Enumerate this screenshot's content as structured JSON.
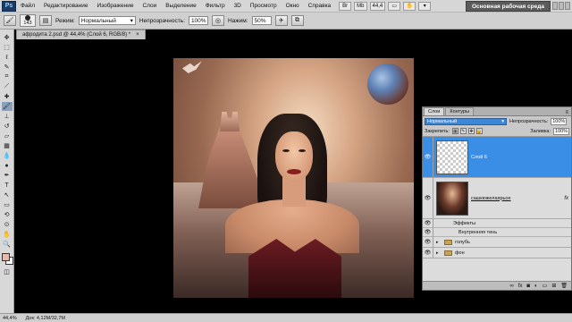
{
  "app": {
    "logo": "Ps"
  },
  "menu": [
    "Файл",
    "Редактирование",
    "Изображение",
    "Слои",
    "Выделение",
    "Фильтр",
    "3D",
    "Просмотр",
    "Окно",
    "Справка"
  ],
  "menu_tools": [
    "Br",
    "Mb",
    "44,4",
    "▭",
    "✋",
    "▾"
  ],
  "workspace_button": "Основная рабочая среда",
  "options": {
    "brush_size": "143",
    "mode_label": "Режим:",
    "mode_value": "Нормальный",
    "opacity_label": "Непрозрачность:",
    "opacity_value": "100%",
    "pressure_label": "Нажим:",
    "pressure_value": "50%"
  },
  "document_tab": "афродита 2.psd @ 44,4% (Слой 6, RGB/8) *",
  "layers_panel": {
    "tabs": [
      "Слои",
      "Контуры"
    ],
    "blend_mode": "Нормальный",
    "opacity_label": "Непрозрачность:",
    "opacity_value": "100%",
    "lock_label": "Закрепить:",
    "fill_label": "Заливка:",
    "fill_value": "100%",
    "layers": [
      {
        "name": "Слой 6",
        "selected": true,
        "thumb": "transparent"
      },
      {
        "name": "сашкюжелаярьое",
        "selected": false,
        "thumb": "photo",
        "fx": "fx"
      }
    ],
    "effects_label": "Эффекты",
    "inner_shadow_label": "Внутренняя тень",
    "groups": [
      "голубь",
      "фон"
    ],
    "bottom_icons": [
      "link-icon",
      "fx-icon",
      "mask-icon",
      "adjustment-icon",
      "group-icon",
      "new-layer-icon",
      "trash-icon"
    ]
  },
  "status": {
    "zoom": "44,4%",
    "doc_info": "Док: 4,12M/32,7M"
  }
}
